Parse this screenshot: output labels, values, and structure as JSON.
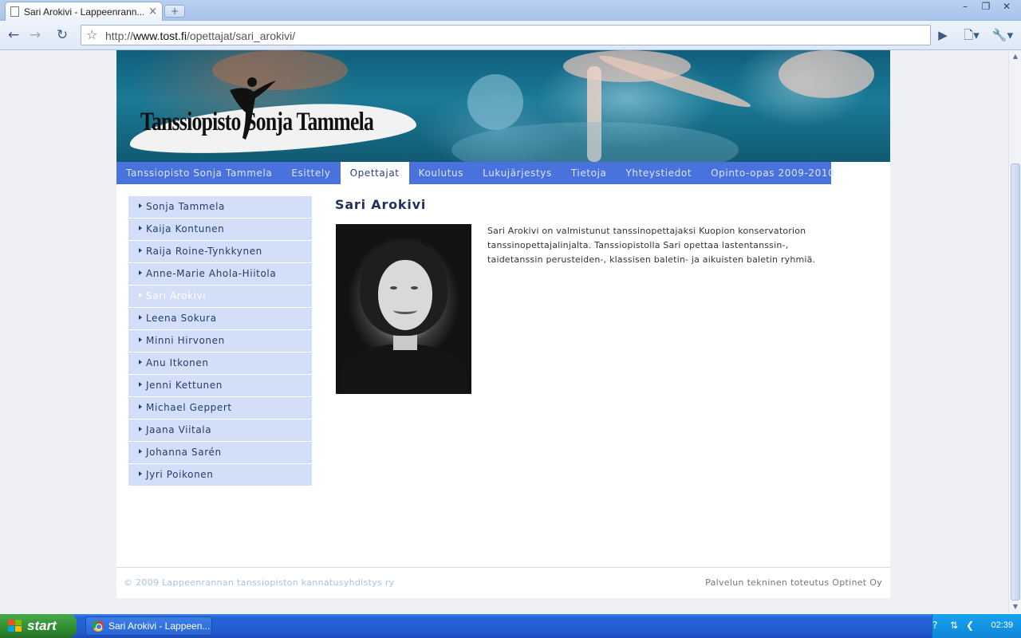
{
  "browser": {
    "tab_title": "Sari Arokivi - Lappeenrann...",
    "tab_close": "×",
    "new_tab": "+",
    "url_prefix": "http://",
    "url_domain": "www.tost.fi",
    "url_path": "/opettajat/sari_arokivi/",
    "window_buttons": [
      "–",
      "❐",
      "✕"
    ]
  },
  "site": {
    "logo_text": "Tanssiopisto   Sonja Tammela",
    "menu": [
      {
        "label": "Tanssiopisto Sonja Tammela",
        "active": false
      },
      {
        "label": "Esittely",
        "active": false
      },
      {
        "label": "Opettajat",
        "active": true
      },
      {
        "label": "Koulutus",
        "active": false
      },
      {
        "label": "Lukujärjestys",
        "active": false
      },
      {
        "label": "Tietoja",
        "active": false
      },
      {
        "label": "Yhteystiedot",
        "active": false
      },
      {
        "label": "Opinto-opas 2009-2010",
        "active": false
      }
    ],
    "teachers": [
      {
        "label": "Sonja Tammela",
        "active": false
      },
      {
        "label": "Kaija Kontunen",
        "active": false
      },
      {
        "label": "Raija Roine-Tynkkynen",
        "active": false
      },
      {
        "label": "Anne-Marie Ahola-Hiitola",
        "active": false
      },
      {
        "label": "Sari Arokivi",
        "active": true
      },
      {
        "label": "Leena Sokura",
        "active": false
      },
      {
        "label": "Minni Hirvonen",
        "active": false
      },
      {
        "label": "Anu Itkonen",
        "active": false
      },
      {
        "label": "Jenni Kettunen",
        "active": false
      },
      {
        "label": "Michael Geppert",
        "active": false
      },
      {
        "label": "Jaana Viitala",
        "active": false
      },
      {
        "label": "Johanna Sarén",
        "active": false
      },
      {
        "label": "Jyri Poikonen",
        "active": false
      }
    ],
    "content": {
      "title": "Sari Arokivi",
      "body": "Sari Arokivi on valmistunut tanssinopettajaksi Kuopion konservatorion tanssinopettajalinjalta. Tanssiopistolla Sari opettaa lastentanssin-, taidetanssin perusteiden-, klassisen baletin- ja aikuisten baletin ryhmiä."
    },
    "footer": {
      "left": "© 2009 Lappeenrannan tanssiopiston kannatusyhdistys ry",
      "right": "Palvelun tekninen toteutus Optinet Oy"
    }
  },
  "taskbar": {
    "start_label": "start",
    "task_label": "Sari Arokivi - Lappeen...",
    "clock": "02:39"
  },
  "colors": {
    "menu_bg": "#4a72dc",
    "sidenav_bg": "#d3def8",
    "title_color": "#24315e"
  }
}
